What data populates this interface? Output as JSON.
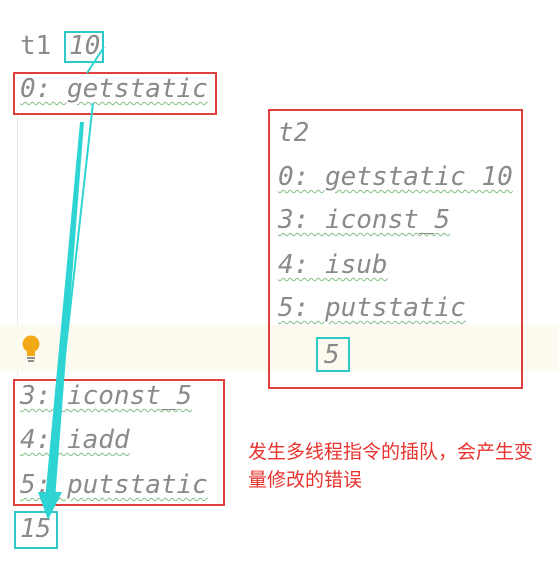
{
  "t1": {
    "label": "t1",
    "value": "10",
    "line0": "0: getstatic",
    "line3": "3: iconst_5",
    "line4": "4: iadd",
    "line5": "5: putstatic",
    "result": "15"
  },
  "t2": {
    "label": "t2",
    "line0": "0: getstatic 10",
    "line3": "3: iconst_5",
    "line4": "4: isub",
    "line5": "5: putstatic",
    "result": "5"
  },
  "note": "发生多线程指令的插队，会产生变量修改的错误",
  "colors": {
    "red_box": "#e0403e",
    "cyan_box": "#2ec8c8",
    "arrow": "#2ed4d4",
    "code_text": "#8a8a8a",
    "note_text": "#e8332e",
    "bulb": "#f2a818"
  },
  "icons": {
    "intention": "lightbulb-icon"
  }
}
